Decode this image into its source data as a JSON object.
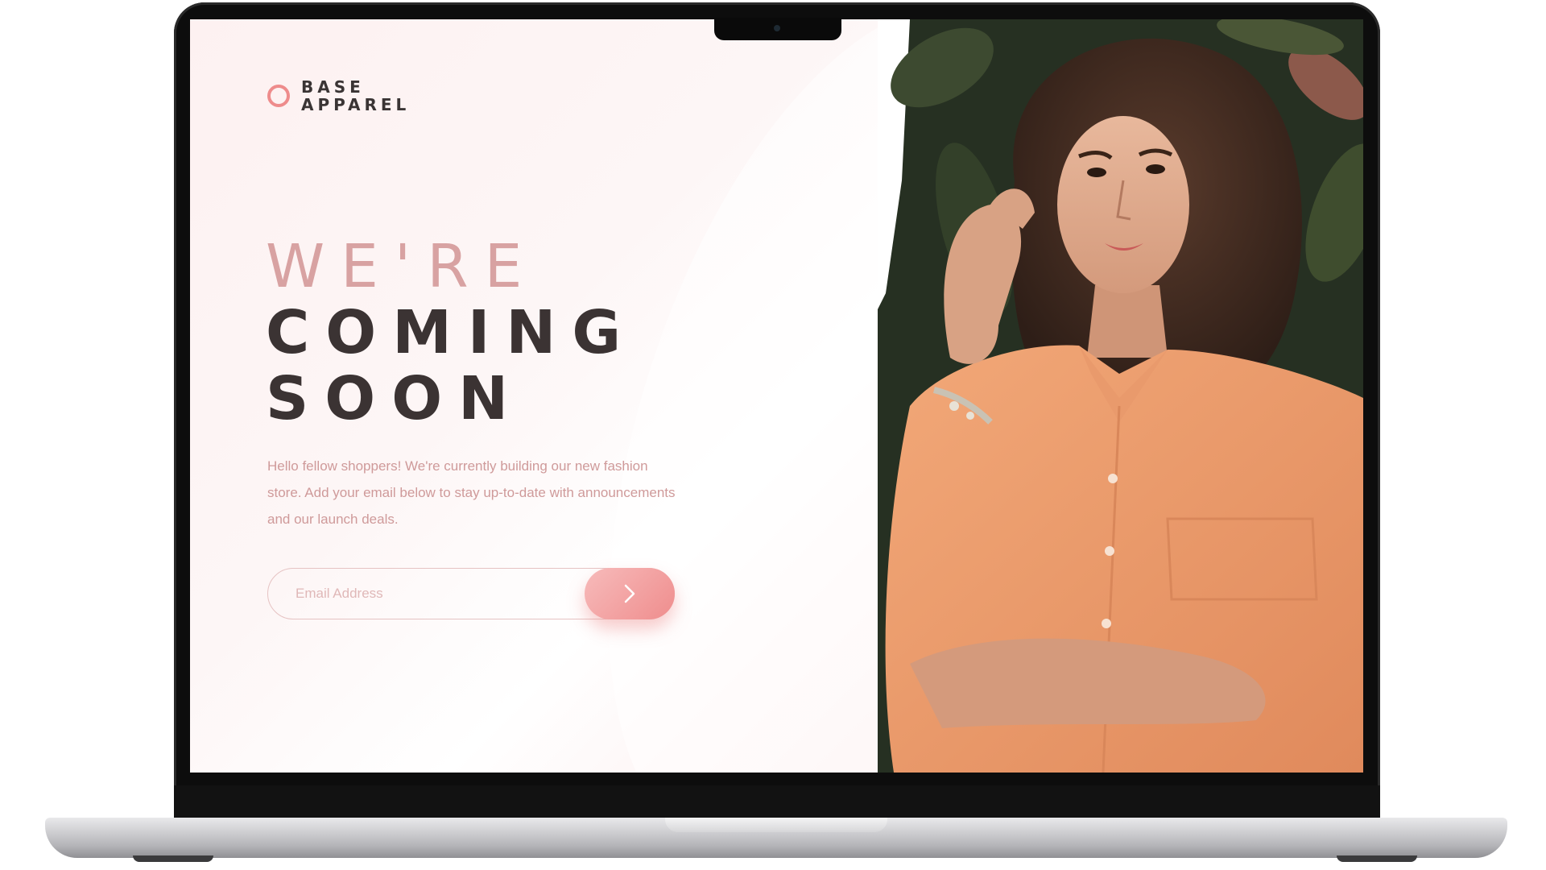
{
  "brand": {
    "line1": "BASE",
    "line2": "APPAREL"
  },
  "headline": {
    "line1": "WE'RE",
    "line2": "COMING",
    "line3": "SOON"
  },
  "description": "Hello fellow shoppers! We're currently building our new fashion store. Add your email below to stay up-to-date with announcements and our launch deals.",
  "email": {
    "placeholder": "Email Address",
    "value": ""
  },
  "submit_icon": "chevron-right-icon",
  "hero_image": "woman-in-orange-shirt-photo",
  "colors": {
    "accent": "#ee8c8c",
    "headline_light": "#d8a2a2",
    "headline_dark": "#3b3333",
    "text_pink": "#cf9a9a",
    "background": "#fdf4f4"
  }
}
